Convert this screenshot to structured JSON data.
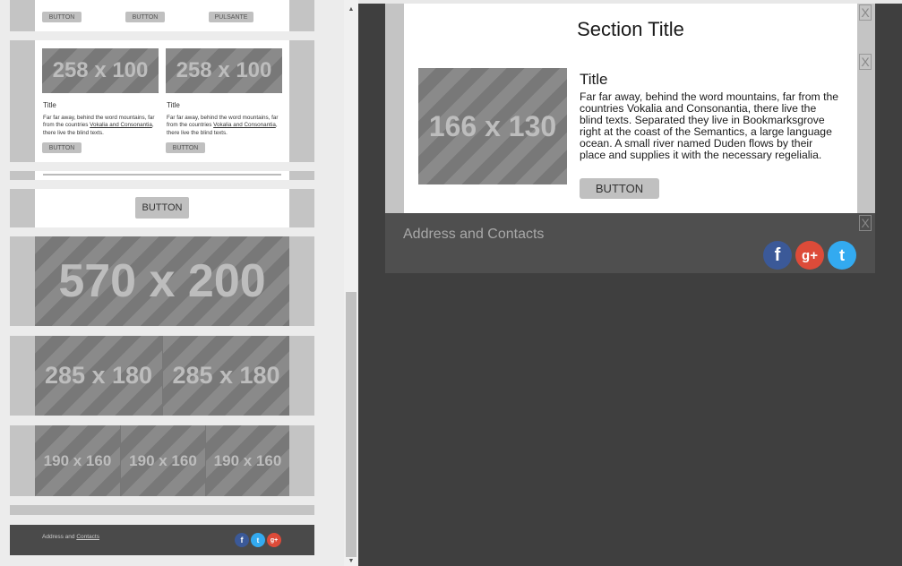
{
  "palette": {
    "top_row": {
      "buttons": [
        "BUTTON",
        "BUTTON",
        "PULSANTE"
      ]
    },
    "two_column": {
      "items": [
        {
          "image": "258 x 100",
          "title": "Title",
          "text_before": "Far far away, behind the word mountains, far from the countries ",
          "link": "Vokalia and Consonantia",
          "text_after": ", there live the blind texts.",
          "button": "BUTTON"
        },
        {
          "image": "258 x 100",
          "title": "Title",
          "text_before": "Far far away, behind the word mountains, far from the countries ",
          "link": "Vokalia and Consonantia",
          "text_after": ", there live the blind texts.",
          "button": "BUTTON"
        }
      ]
    },
    "button_row": {
      "button": "BUTTON"
    },
    "image_570": "570 x 200",
    "images_285": [
      "285 x 180",
      "285 x 180"
    ],
    "images_190": [
      "190 x 160",
      "190 x 160",
      "190 x 160"
    ],
    "footer": {
      "address": "Address and ",
      "contacts_link": "Contacts",
      "social": [
        "facebook-icon",
        "twitter-icon",
        "google-plus-icon"
      ]
    }
  },
  "canvas": {
    "section_title": "Section Title",
    "image": "166 x 130",
    "item_title": "Title",
    "item_text_1": "Far far away, behind the word mountains, far from the countries ",
    "item_link": "Vokalia and Consonantia",
    "item_text_2": ", there live the blind texts. Separated they live in Bookmarksgrove right at the coast of the Semantics, a large language ocean. A small river named Duden flows by their place and supplies it with the necessary regelialia.",
    "item_button": "BUTTON",
    "close_symbol": "X",
    "footer_address": "Address and Contacts",
    "social": [
      {
        "icon": "facebook-icon",
        "glyph": "f",
        "color": "#3b5998"
      },
      {
        "icon": "google-plus-icon",
        "glyph": "g+",
        "color": "#dd4b39"
      },
      {
        "icon": "twitter-icon",
        "glyph": "t",
        "color": "#33aaf0"
      }
    ]
  },
  "colors": {
    "canvas_bg": "#3f3f3f",
    "panel_bg": "#ececec",
    "placeholder": "#808080"
  }
}
